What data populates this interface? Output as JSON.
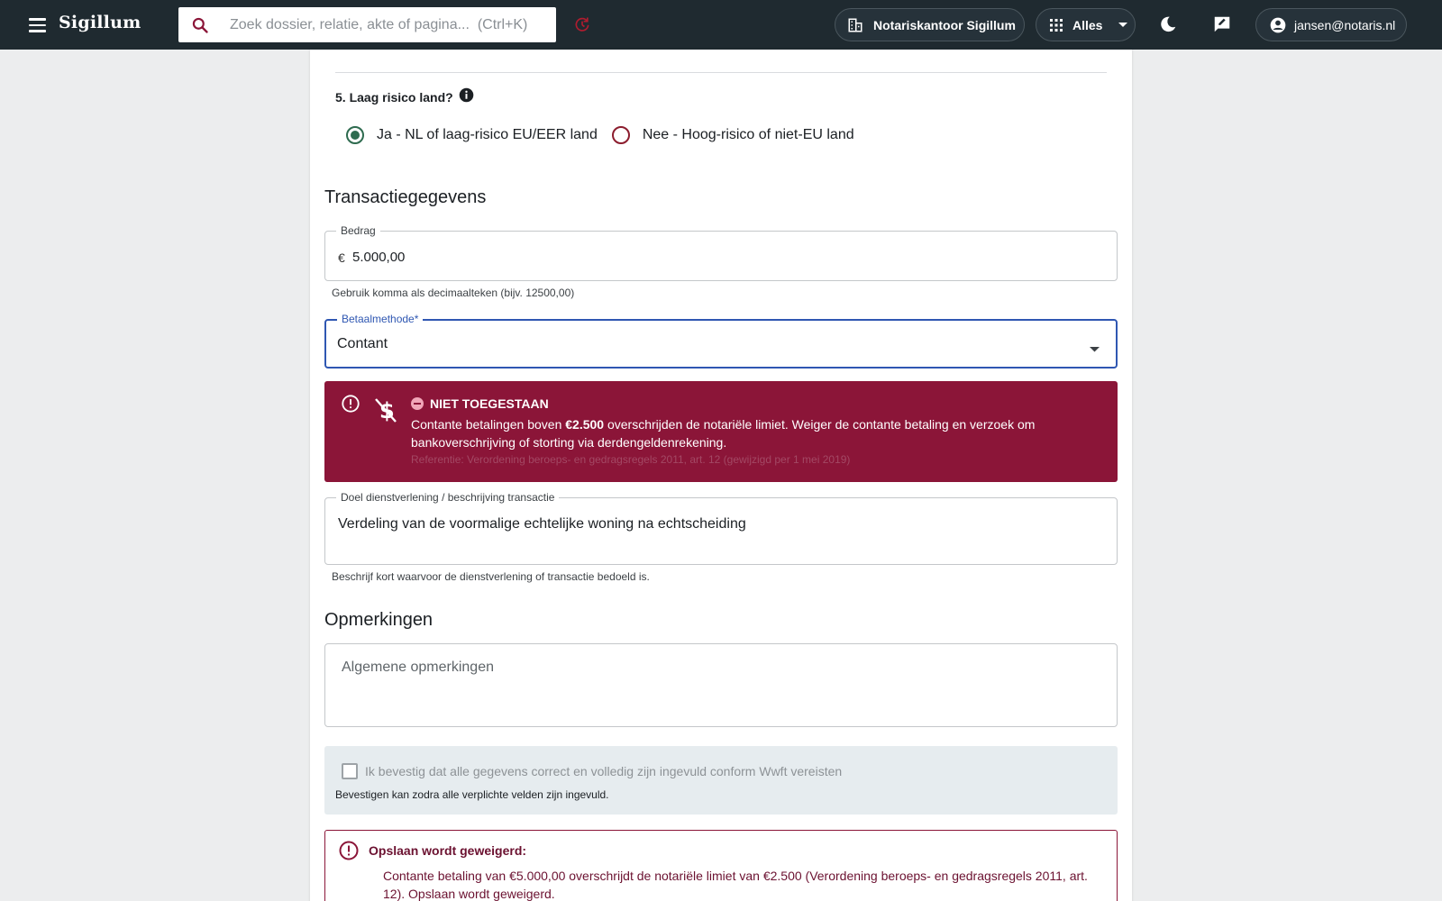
{
  "app": {
    "title": "Sigillum"
  },
  "search": {
    "placeholder": "Zoek dossier, relatie, akte of pagina...  (Ctrl+K)"
  },
  "header": {
    "office_label": "Notariskantoor Sigillum",
    "scope_label": "Alles",
    "user_email": "jansen@notaris.nl"
  },
  "question5": {
    "label": "5. Laag risico land?",
    "options": [
      {
        "label": "Ja - NL of laag-risico EU/EER land",
        "selected": true
      },
      {
        "label": "Nee - Hoog-risico of niet-EU land",
        "selected": false
      }
    ]
  },
  "transactie": {
    "title": "Transactiegegevens",
    "bedrag": {
      "label": "Bedrag",
      "currency": "€",
      "value": "5.000,00",
      "hint": "Gebruik komma als decimaalteken (bijv. 12500,00)"
    },
    "betaalmethode": {
      "label": "Betaalmethode*",
      "value": "Contant"
    },
    "alert": {
      "title": "NIET TOEGESTAAN",
      "msg_before": "Contante betalingen boven ",
      "msg_bold": "€2.500",
      "msg_after": " overschrijden de notariële limiet. Weiger de contante betaling en verzoek om bankoverschrijving of storting via derdengeldenrekening.",
      "reference": "Referentie: Verordening beroeps- en gedragsregels 2011, art. 12 (gewijzigd per 1 mei 2019)"
    },
    "doel": {
      "label": "Doel dienstverlening / beschrijving transactie",
      "value": "Verdeling van de voormalige echtelijke woning na echtscheiding",
      "hint": "Beschrijf kort waarvoor de dienstverlening of transactie bedoeld is."
    }
  },
  "opmerkingen": {
    "title": "Opmerkingen",
    "placeholder": "Algemene opmerkingen"
  },
  "confirm": {
    "label": "Ik bevestig dat alle gegevens correct en volledig zijn ingevuld conform Wwft vereisten",
    "sub": "Bevestigen kan zodra alle verplichte velden zijn ingevuld."
  },
  "save_error": {
    "title": "Opslaan wordt geweigerd:",
    "message": "Contante betaling van €5.000,00 overschrijdt de notariële limiet van €2.500 (Verordening beroeps- en gedragsregels 2011, art. 12). Opslaan wordt geweigerd."
  },
  "colors": {
    "topbar": "#1f2a30",
    "accent_green": "#2e6b4f",
    "error": "#8b1538",
    "focus_blue": "#2f57b2"
  },
  "icons": [
    "menu-icon",
    "search-icon",
    "reload-icon",
    "building-icon",
    "apps-grid-icon",
    "chevron-down-icon",
    "moon-icon",
    "feedback-icon",
    "account-icon",
    "info-icon",
    "alert-circle-icon",
    "no-dollar-icon",
    "stop-icon"
  ]
}
